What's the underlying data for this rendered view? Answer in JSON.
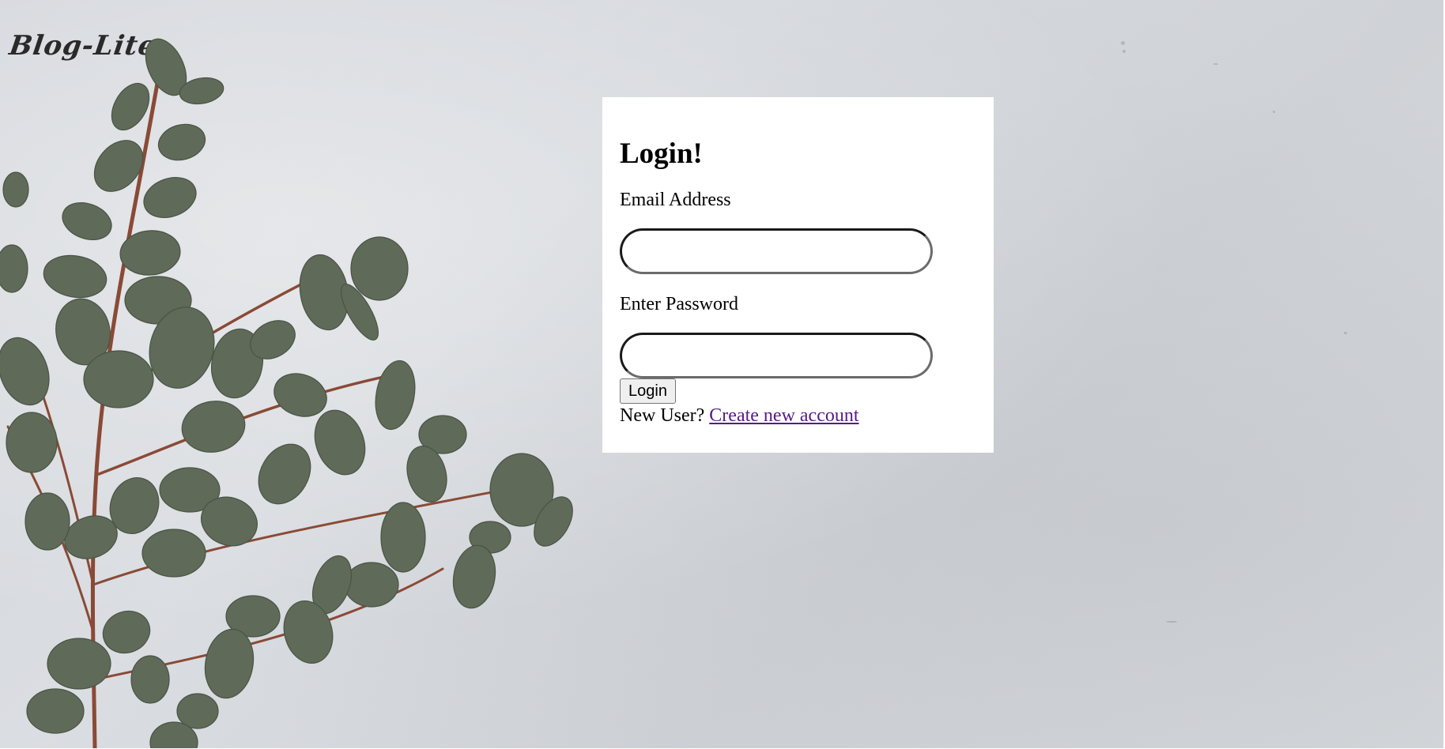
{
  "brand": {
    "logo_text": "Blog-Lite"
  },
  "login": {
    "title": "Login!",
    "email_label": "Email Address",
    "email_value": "",
    "password_label": "Enter Password",
    "password_value": "",
    "submit_label": "Login",
    "new_user_text": "New User?",
    "create_account_link": "Create new account"
  },
  "colors": {
    "background": "#d6d9dd",
    "card": "#ffffff",
    "link_visited": "#551a8b",
    "leaf": "#5f6a58",
    "stem": "#8a4a36"
  },
  "icons": [
    "eucalyptus-branch-illustration"
  ]
}
